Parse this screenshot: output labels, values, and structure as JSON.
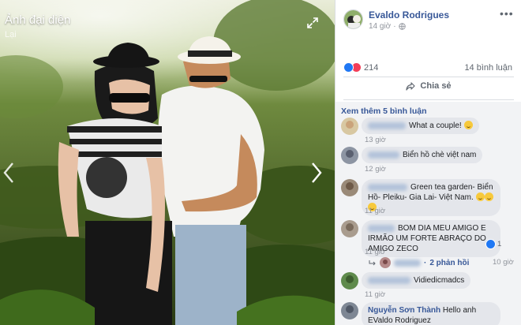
{
  "photo": {
    "album_title": "Ảnh đại diện",
    "album_subtitle": "Lại",
    "icons": {
      "expand": "expand-icon",
      "prev": "chevron-left-icon",
      "next": "chevron-right-icon"
    }
  },
  "post": {
    "author": "Evaldo Rodrigues",
    "time": "14 giờ",
    "privacy_icon": "globe-icon",
    "more_icon": "more-options-icon",
    "reaction_count": "214",
    "comment_count": "14 bình luận",
    "share_label": "Chia sẻ"
  },
  "comments": {
    "view_more": "Xem thêm 5 bình luận",
    "items": [
      {
        "author": "",
        "text": "What a couple!",
        "time": "13 giờ"
      },
      {
        "author": "",
        "text": "Biển hồ chè việt nam",
        "time": "12 giờ"
      },
      {
        "author": "",
        "text": "Green tea garden- Biển Hồ- Pleiku- Gia Lai- Việt Nam.",
        "time": "11 giờ"
      },
      {
        "author": "",
        "text": "BOM DIA MEU AMIGO E IRMÃO UM FORTE ABRAÇO DO AMIGO ZECO",
        "time": "11 giờ",
        "reaction_count": "1",
        "replies_label": "2 phản hồi",
        "replies_time": "10 giờ"
      },
      {
        "author": "",
        "text": "Vidiedicmadcs",
        "time": "11 giờ"
      },
      {
        "author": "Nguyễn Sơn Thành",
        "text": "Hello anh EValdo Rodriguez",
        "time": ""
      }
    ]
  },
  "colors": {
    "link": "#385898",
    "like": "#2078f4",
    "love": "#f33e58",
    "comment_bg": "#e4e6eb"
  }
}
